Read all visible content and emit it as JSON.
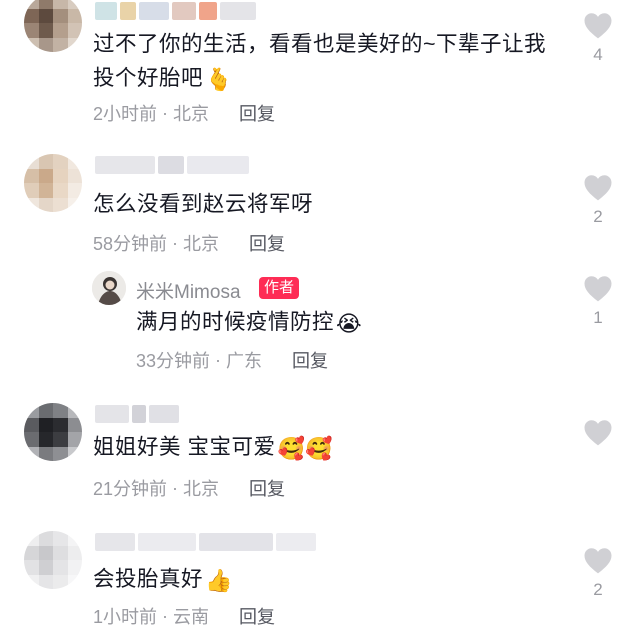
{
  "colors": {
    "text": "#161823",
    "meta": "#9a9ba1",
    "reply": "#565861",
    "author_tag": "#fe2c55",
    "heart": "#d0d0d4"
  },
  "comments": [
    {
      "text": "过不了你的生活，看看也是美好的~下辈子让我投个好胎吧",
      "emoji": "🫰",
      "emoji_icon": "finger-heart-icon",
      "time": "2小时前",
      "location": "北京",
      "reply": "回复",
      "likes": "4"
    },
    {
      "text": "怎么没看到赵云将军呀",
      "time": "58分钟前",
      "location": "北京",
      "reply": "回复",
      "likes": "2"
    },
    {
      "username": "米米Mimosa",
      "author_tag": "作者",
      "text": "满月的时候疫情防控",
      "emoji": "😭",
      "emoji_icon": "crying-face-icon",
      "time": "33分钟前",
      "location": "广东",
      "reply": "回复",
      "likes": "1"
    },
    {
      "text": "姐姐好美 宝宝可爱",
      "emoji": "🥰🥰",
      "emoji_icon": "heart-eyes-face-icon",
      "time": "21分钟前",
      "location": "北京",
      "reply": "回复",
      "likes": ""
    },
    {
      "text": "会投胎真好",
      "emoji": "👍",
      "emoji_icon": "thumbs-up-icon",
      "time": "1小时前",
      "location": "云南",
      "reply": "回复",
      "likes": "2"
    }
  ]
}
